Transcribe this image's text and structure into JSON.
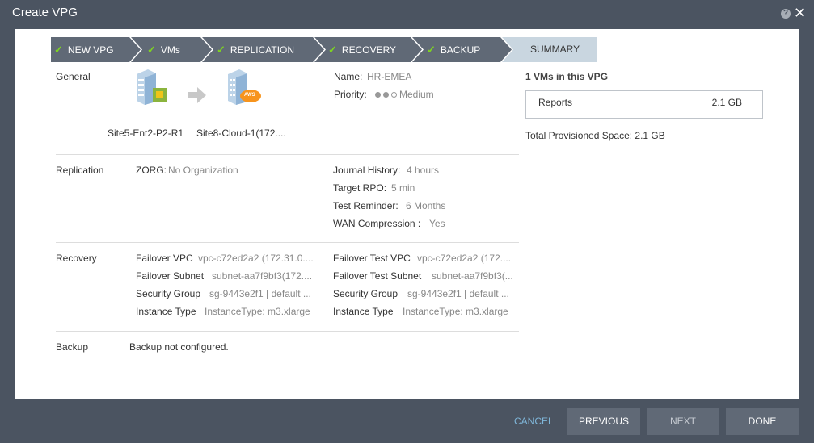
{
  "window": {
    "title": "Create VPG",
    "help_glyph": "?",
    "close_glyph": "✕"
  },
  "steps": [
    {
      "label": "NEW VPG",
      "done": true
    },
    {
      "label": "VMs",
      "done": true
    },
    {
      "label": "REPLICATION",
      "done": true
    },
    {
      "label": "RECOVERY",
      "done": true
    },
    {
      "label": "BACKUP",
      "done": true
    },
    {
      "label": "SUMMARY",
      "done": false
    }
  ],
  "check_glyph": "✓",
  "general": {
    "label": "General",
    "source_site": "Site5-Ent2-P2-R1",
    "target_site": "Site8-Cloud-1(172....",
    "aws_badge": "AWS",
    "name_label": "Name:",
    "name_value": "HR-EMEA",
    "priority_label": "Priority:",
    "priority_value": "Medium",
    "priority_level": 2
  },
  "replication": {
    "label": "Replication",
    "zorg_label": "ZORG:",
    "zorg_value": "No Organization",
    "journal_label": "Journal History:",
    "journal_value": "4 hours",
    "rpo_label": "Target RPO:",
    "rpo_value": "5 min",
    "test_label": "Test Reminder:",
    "test_value": "6 Months",
    "wan_label": "WAN Compression :",
    "wan_value": "Yes"
  },
  "recovery": {
    "label": "Recovery",
    "failover_vpc_label": "Failover VPC",
    "failover_vpc_value": "vpc-c72ed2a2 (172.31.0....",
    "failover_subnet_label": "Failover Subnet",
    "failover_subnet_value": "subnet-aa7f9bf3(172....",
    "security_group_label": "Security Group",
    "security_group_value": "sg-9443e2f1 | default ...",
    "instance_type_label": "Instance Type",
    "instance_type_value": "InstanceType: m3.xlarge",
    "test_vpc_label": "Failover Test VPC",
    "test_vpc_value": "vpc-c72ed2a2 (172....",
    "test_subnet_label": "Failover Test Subnet",
    "test_subnet_value": "subnet-aa7f9bf3(...",
    "test_security_group_label": "Security Group",
    "test_security_group_value": "sg-9443e2f1 | default ...",
    "test_instance_type_label": "Instance Type",
    "test_instance_type_value": "InstanceType: m3.xlarge"
  },
  "backup": {
    "label": "Backup",
    "value": "Backup not configured."
  },
  "summary": {
    "vms_header": "1 VMs in this VPG",
    "vm_name": "Reports",
    "vm_size": "2.1 GB",
    "total_label": "Total Provisioned Space: 2.1 GB"
  },
  "footer": {
    "cancel": "CANCEL",
    "previous": "PREVIOUS",
    "next": "NEXT",
    "done": "DONE"
  },
  "colors": {
    "step_done": "#606976",
    "step_active": "#c9d6e0",
    "check": "#7ed321",
    "aws": "#f7941d"
  }
}
